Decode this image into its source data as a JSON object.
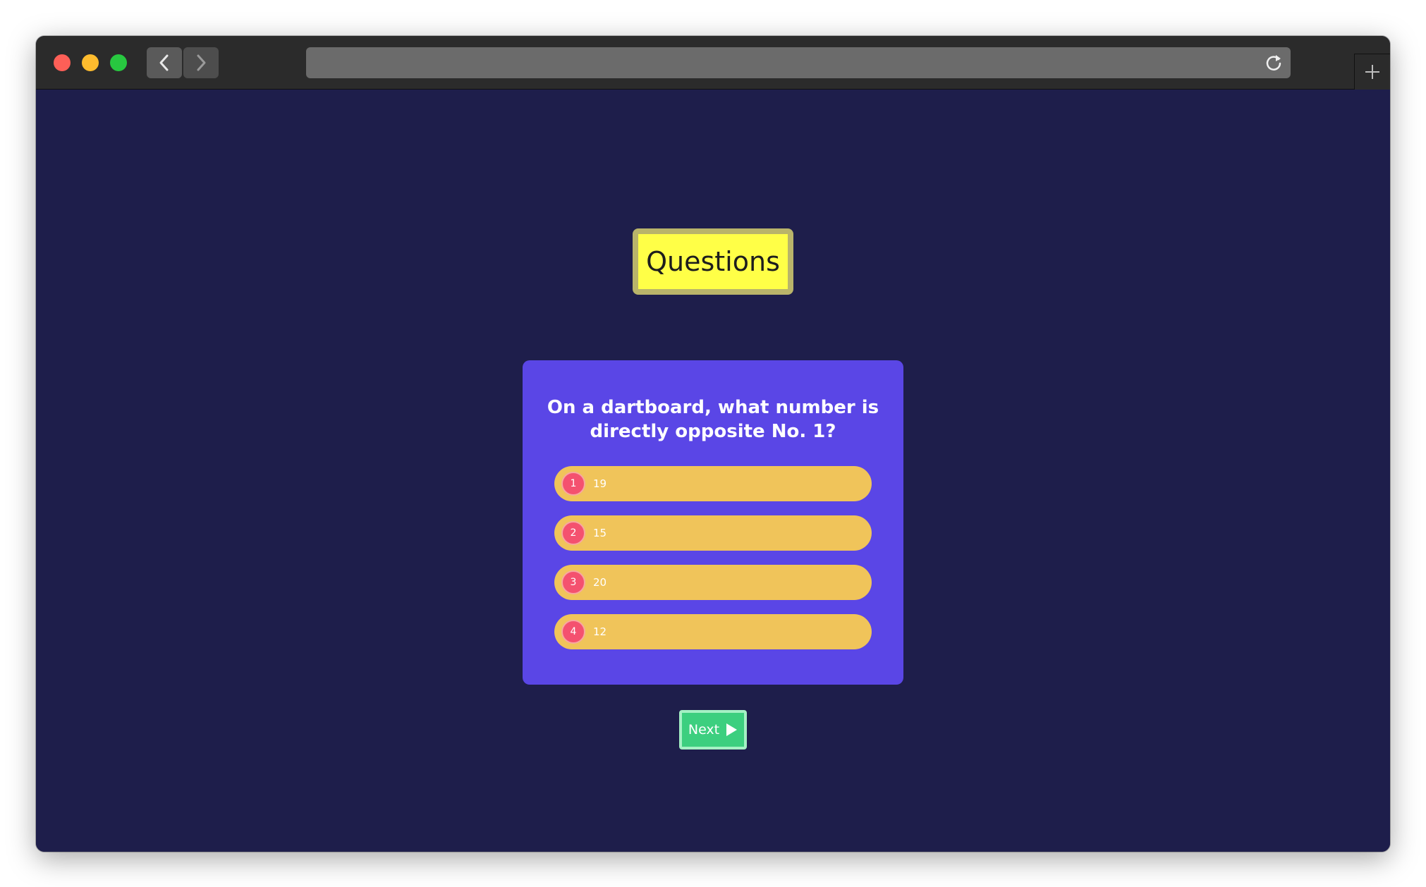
{
  "browser": {
    "url": "",
    "icons": {
      "back": "chevron-left-icon",
      "forward": "chevron-right-icon",
      "reload": "reload-icon",
      "new_tab": "plus-icon"
    }
  },
  "page": {
    "heading": "Questions",
    "question": "On a dartboard, what number is directly opposite No. 1?",
    "options": [
      {
        "number": "1",
        "label": "19"
      },
      {
        "number": "2",
        "label": "15"
      },
      {
        "number": "3",
        "label": "20"
      },
      {
        "number": "4",
        "label": "12"
      }
    ],
    "next_label": "Next"
  },
  "colors": {
    "background": "#1e1e4b",
    "card": "#5a46e6",
    "heading_badge": "#ffff47",
    "option": "#f0c45a",
    "option_number": "#f4516f",
    "next_button": "#3ccf7f"
  }
}
